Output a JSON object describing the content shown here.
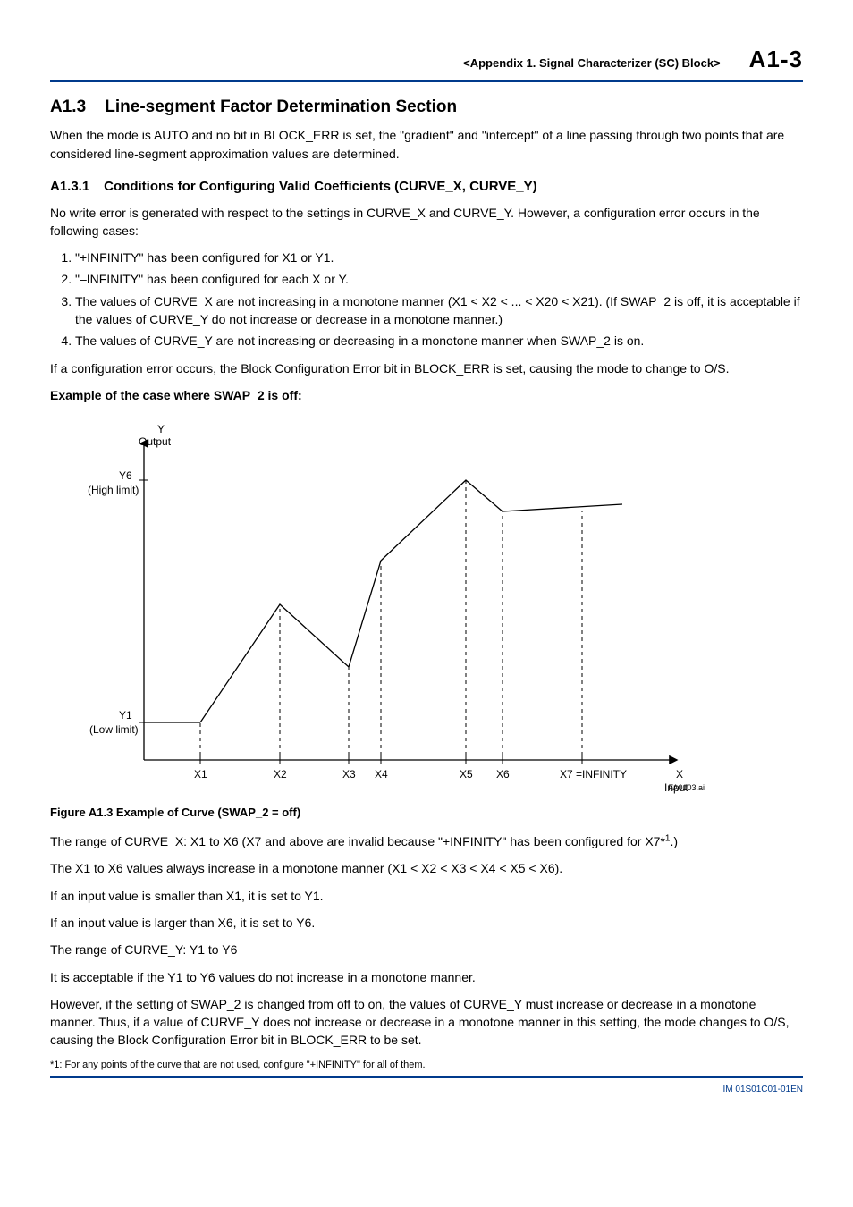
{
  "header": {
    "breadcrumb": "<Appendix 1.  Signal Characterizer (SC) Block>",
    "page": "A1-3"
  },
  "section": {
    "num": "A1.3",
    "title": "Line-segment Factor Determination Section",
    "intro": "When the mode is AUTO and no bit in BLOCK_ERR is set, the \"gradient\" and \"intercept\" of a line passing through two points that are considered line-segment approximation values are determined."
  },
  "subsection": {
    "num": "A1.3.1",
    "title": "Conditions for Configuring Valid Coefficients (CURVE_X, CURVE_Y)",
    "intro": "No write error is generated with respect to the settings in CURVE_X and CURVE_Y. However, a configuration error occurs in the following cases:",
    "items": [
      "\"+INFINITY\" has been configured for X1 or Y1.",
      "\"–INFINITY\" has been configured for each X or Y.",
      "The values of CURVE_X are not increasing in a monotone manner (X1 < X2 < ... < X20 < X21). (If SWAP_2 is off, it is acceptable if the values of CURVE_Y do not increase or decrease in a monotone manner.)",
      "The values of CURVE_Y are not increasing or decreasing in a monotone manner when SWAP_2 is on."
    ],
    "after_list": "If a configuration error occurs, the Block Configuration Error bit in BLOCK_ERR is set, causing the mode to change to O/S."
  },
  "example_heading": "Example of the case where SWAP_2 is off:",
  "chart_data": {
    "type": "line",
    "title": "",
    "x_axis_label_top": "Y",
    "x_axis_label_top2": "Output",
    "y_labels_left": {
      "high": "Y6",
      "high_sub": "(High limit)",
      "low": "Y1",
      "low_sub": "(Low limit)"
    },
    "x_ticks": [
      "X1",
      "X2",
      "X3",
      "X4",
      "X5",
      "X6",
      "X7 =INFINITY"
    ],
    "x_axis_right_label": "X",
    "x_axis_right_label2": "Input",
    "points": [
      {
        "x": 0.1,
        "y": 0.12
      },
      {
        "x": 0.25,
        "y": 0.5
      },
      {
        "x": 0.38,
        "y": 0.3
      },
      {
        "x": 0.44,
        "y": 0.64
      },
      {
        "x": 0.6,
        "y": 0.9
      },
      {
        "x": 0.67,
        "y": 0.8
      },
      {
        "x": 0.82,
        "y": 0.8
      }
    ],
    "left_flat_y": 0.12,
    "right_flat_y": 0.8,
    "code": "FA0103.ai"
  },
  "figure_caption": "Figure A1.3    Example of Curve (SWAP_2 = off)",
  "body_paragraphs": {
    "p1a": "The range of CURVE_X: X1 to X6 (X7 and above are invalid because \"+INFINITY\" has been configured for X7*",
    "p1b": ".)",
    "p2": "The X1 to X6 values always increase in a monotone manner (X1 < X2 < X3 < X4 < X5 < X6).",
    "p3": "If an input value is smaller than X1, it is set to Y1.",
    "p4": "If an input value is larger than X6, it is set to Y6.",
    "p5": "The range of CURVE_Y: Y1 to Y6",
    "p6": "It is acceptable if the Y1 to Y6 values do not increase in a monotone manner.",
    "p7": "However, if the setting of SWAP_2 is changed from off to on, the values of CURVE_Y must increase or decrease in a monotone manner. Thus, if a value of CURVE_Y does not increase or decrease in a monotone manner in this setting, the mode changes to O/S, causing the Block Configuration Error bit in BLOCK_ERR to be set."
  },
  "footnote": "*1: For any points of the curve that are not used, configure \"+INFINITY\" for all of them.",
  "doc_code": "IM 01S01C01-01EN",
  "sup1": "1"
}
